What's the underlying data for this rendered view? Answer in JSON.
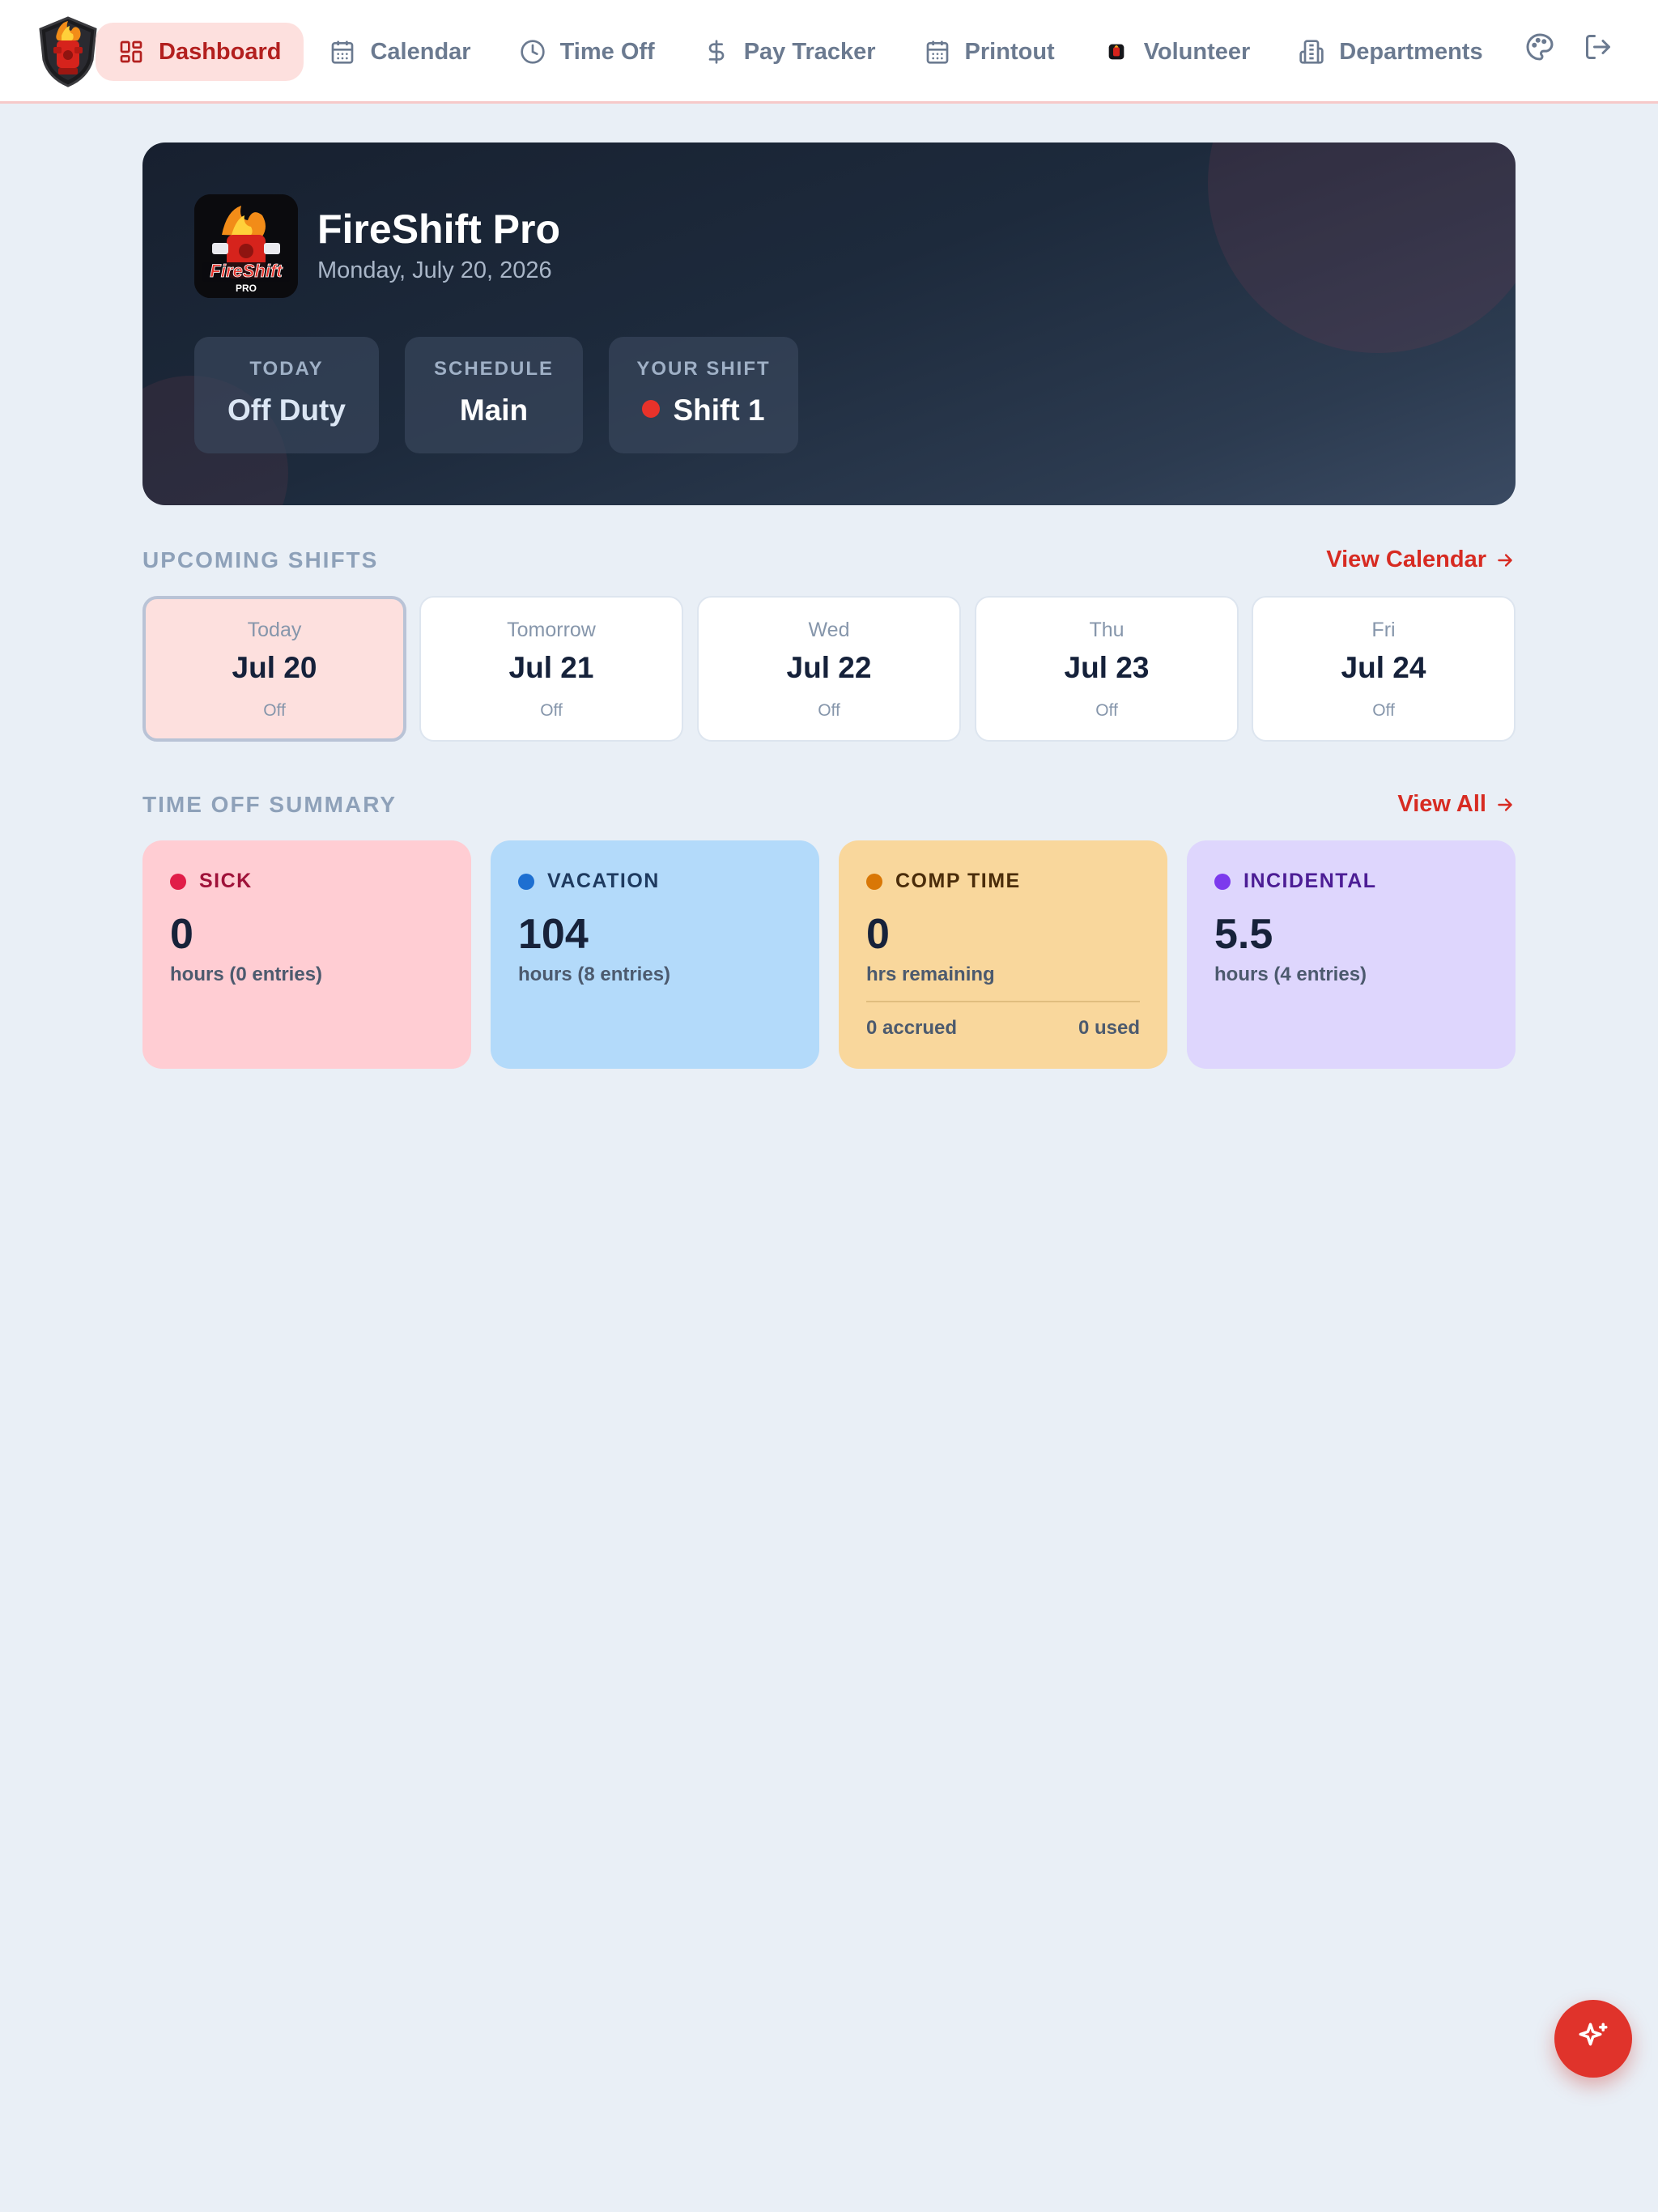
{
  "nav": {
    "items": [
      {
        "label": "Dashboard",
        "icon": "dashboard-icon",
        "active": true
      },
      {
        "label": "Calendar",
        "icon": "calendar-icon"
      },
      {
        "label": "Time Off",
        "icon": "clock-icon"
      },
      {
        "label": "Pay Tracker",
        "icon": "dollar-icon"
      },
      {
        "label": "Printout",
        "icon": "calendar-icon"
      },
      {
        "label": "Volunteer",
        "icon": "volunteer-app-icon"
      },
      {
        "label": "Departments",
        "icon": "building-icon"
      }
    ],
    "right_icons": [
      "palette-icon",
      "logout-icon"
    ]
  },
  "hero": {
    "logo_text": "FireShift",
    "logo_subtext": "PRO",
    "title": "FireShift Pro",
    "date": "Monday, July 20, 2026",
    "stats": [
      {
        "label": "TODAY",
        "value": "Off Duty"
      },
      {
        "label": "SCHEDULE",
        "value": "Main"
      },
      {
        "label": "YOUR SHIFT",
        "value": "Shift 1",
        "dot_color": "#e8322a"
      }
    ]
  },
  "upcoming": {
    "title": "UPCOMING SHIFTS",
    "link": "View Calendar",
    "days": [
      {
        "day": "Today",
        "date": "Jul 20",
        "status": "Off",
        "selected": true
      },
      {
        "day": "Tomorrow",
        "date": "Jul 21",
        "status": "Off"
      },
      {
        "day": "Wed",
        "date": "Jul 22",
        "status": "Off"
      },
      {
        "day": "Thu",
        "date": "Jul 23",
        "status": "Off"
      },
      {
        "day": "Fri",
        "date": "Jul 24",
        "status": "Off"
      }
    ]
  },
  "timeoff": {
    "title": "TIME OFF SUMMARY",
    "link": "View All",
    "cards": [
      {
        "label": "SICK",
        "value": "0",
        "sub": "hours (0 entries)",
        "bg": "#ffcdd3",
        "dot": "#e11d48",
        "label_color": "#9f1239"
      },
      {
        "label": "VACATION",
        "value": "104",
        "sub": "hours (8 entries)",
        "bg": "#b3dafa",
        "dot": "#1d6fd1",
        "label_color": "#1e3a5f"
      },
      {
        "label": "COMP TIME",
        "value": "0",
        "sub": "hrs remaining",
        "accrued": "0 accrued",
        "used": "0 used",
        "bg": "#f9d79c",
        "dot": "#d97706",
        "label_color": "#4a2c0a"
      },
      {
        "label": "INCIDENTAL",
        "value": "5.5",
        "sub": "hours (4 entries)",
        "bg": "#ded6fd",
        "dot": "#7c3aed",
        "label_color": "#4c1d95"
      }
    ]
  },
  "fab": {
    "icon": "sparkle-icon"
  },
  "colors": {
    "accent": "#d72b22",
    "page_bg": "#e9eff6",
    "hero_bg": "#1d2a3c"
  }
}
